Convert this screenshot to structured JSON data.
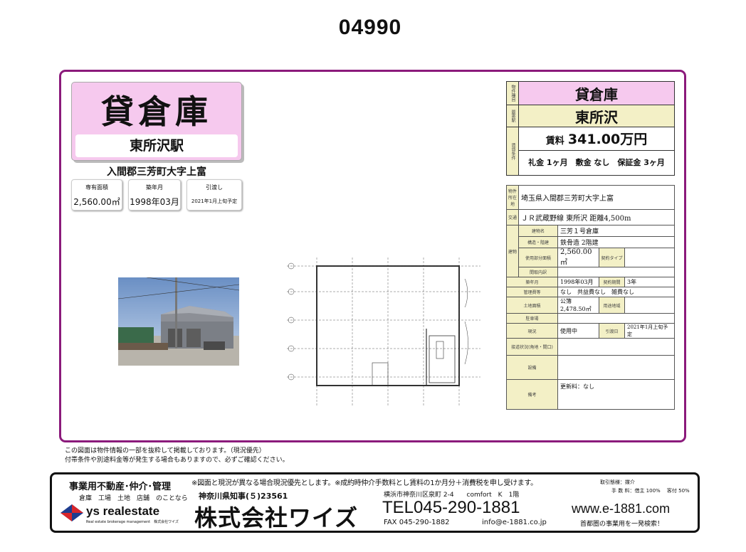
{
  "page_id": "04990",
  "title_card": {
    "type": "貸倉庫",
    "station": "東所沢駅"
  },
  "address": "入間郡三芳町大字上富",
  "mini_boxes": [
    {
      "label": "専有面積",
      "value": "2,560.00㎡"
    },
    {
      "label": "築年月",
      "value": "1998年03月"
    },
    {
      "label": "引渡し",
      "value": "2021年1月上旬予定"
    }
  ],
  "summary": {
    "label_type": "物件種目",
    "type": "貸倉庫",
    "label_station": "最寄駅",
    "station": "東所沢",
    "label_terms": "賃貸条件",
    "rent_label": "賃料",
    "rent": "341.00万円",
    "terms": "礼金 1ヶ月　敷金 なし　保証金 3ヶ月"
  },
  "details": {
    "location_label": "物件所在地",
    "location": "埼玉県入間郡三芳町大字上富",
    "transport_label": "交通",
    "transport": "ＪＲ武蔵野線 東所沢 距離4,500m",
    "building_label": "建物",
    "name_label": "建物名",
    "name": "三芳１号倉庫",
    "structure_label": "構造・階建",
    "structure": "鉄骨造 2階建",
    "area_label": "使用部分面積",
    "area": "2,560.00㎡",
    "contract_type_label": "契約タイプ",
    "layout_label": "間取内訳",
    "built_label": "築年月",
    "built": "1998年03月",
    "period_label": "契約期間",
    "period": "3年",
    "fee_label": "管理費等",
    "fee": "なし　共益費なし　雑費なし",
    "land_label": "土地面積",
    "land": "公簿 2,478.50㎡",
    "zoning_label": "用途地域",
    "parking_label": "駐車場",
    "status_label": "現況",
    "status": "使用中",
    "handover_label": "引渡日",
    "handover": "2021年1月上旬予定",
    "access_label": "接道状況(角地・間口)",
    "equipment_label": "設備",
    "remarks_label": "備考",
    "remarks": "更新料：なし"
  },
  "notes": [
    "この図面は物件情報の一部を抜粋して掲載しております。（現況優先）",
    "付帯条件や別途料金等が発生する場合もありますので、必ずご確認ください。"
  ],
  "footer": {
    "business": "事業用不動産･仲介･管理",
    "categories": "倉庫　工場　土地　店舗　のことなら",
    "logo_text": "ys realestate",
    "logo_sub": "Real estate brokerage management　株式会社ワイズ",
    "disclaimer": "※図面と現況が異なる場合現況優先とします。※成約時仲介手数料とし賃料の1か月分＋消費税を申し受けます。",
    "license": "神奈川県知事(５)23561",
    "company": "株式会社ワイズ",
    "company_address": "横浜市神奈川区泉町 2-4　　comfort　K　1階",
    "tel": "TEL045-290-1881",
    "fax": "FAX 045-290-1882",
    "email": "info@e-1881.co.jp",
    "deal_label": "取引態様：媒介",
    "fee_split": "手 数 料：借主 100%　 客付 50%",
    "website": "www.e-1881.com",
    "tagline": "首都圏の事業用を一発検索！"
  },
  "colors": {
    "frame": "#8b1a7b",
    "pink": "#f6c9ee",
    "cream": "#f3f0c6",
    "logo_red": "#d8262b",
    "logo_blue": "#1e3d8f"
  }
}
